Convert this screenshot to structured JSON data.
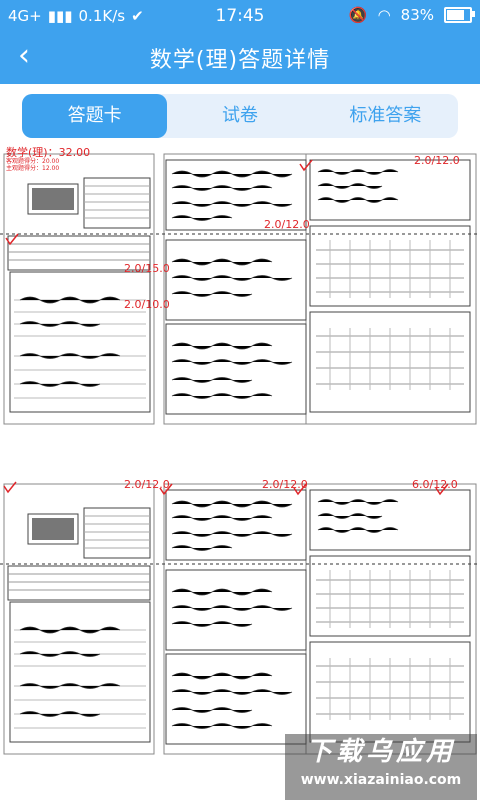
{
  "status": {
    "network": "4G+",
    "speed": "0.1K/s",
    "time": "17:45",
    "battery": "83%",
    "battery_level": 0.83
  },
  "header": {
    "title": "数学(理)答题详情"
  },
  "tabs": [
    {
      "label": "答题卡",
      "active": true
    },
    {
      "label": "试卷",
      "active": false
    },
    {
      "label": "标准答案",
      "active": false
    }
  ],
  "sheet1": {
    "header_score": "数学(理)：32.00",
    "subjective_score": "客观题得分：20.00",
    "objective_score": "主观题得分：12.00",
    "page_title": "2018-2019学年普通高中高二下学期期末教学质量检测",
    "page_subtitle": "语文答题卡",
    "student_name": "付婧月",
    "scores": [
      "2.0/12.0",
      "2.0/12.0",
      "2.0/15.0",
      "2.0/10.0"
    ]
  },
  "sheet2": {
    "page_title": "2018-2019学年普通高中高二下学期期末教学质量检测",
    "page_subtitle": "语文答题卡",
    "student_name": "付婧月",
    "scores": [
      "2.0/12.0",
      "2.0/12.0",
      "6.0/12.0"
    ]
  },
  "watermark": {
    "line1": "下载乌应用",
    "line2": "www.xiazainiao.com"
  }
}
